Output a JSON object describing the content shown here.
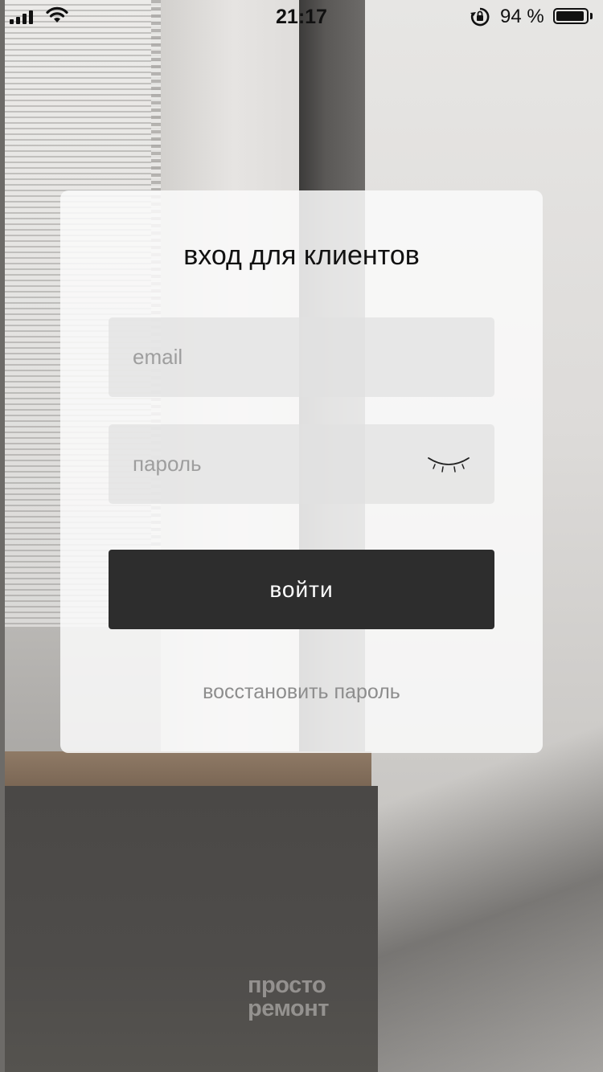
{
  "status_bar": {
    "time": "21:17",
    "battery_percent": "94 %",
    "battery_level": 0.94,
    "icons": [
      "signal-icon",
      "wifi-icon",
      "rotation-lock-icon",
      "battery-icon"
    ]
  },
  "login_card": {
    "title": "вход для клиентов",
    "email_placeholder": "email",
    "password_placeholder": "пароль",
    "email_value": "",
    "password_value": "",
    "eye_icon": "eye-closed-icon",
    "login_button_label": "войти",
    "restore_link_label": "восстановить пароль"
  },
  "brand": {
    "line1": "просто",
    "line2": "ремонт"
  },
  "colors": {
    "button_bg": "#2d2d2d",
    "button_text": "#ffffff",
    "link_text": "#8d8d8d",
    "placeholder": "#9e9e9e"
  }
}
